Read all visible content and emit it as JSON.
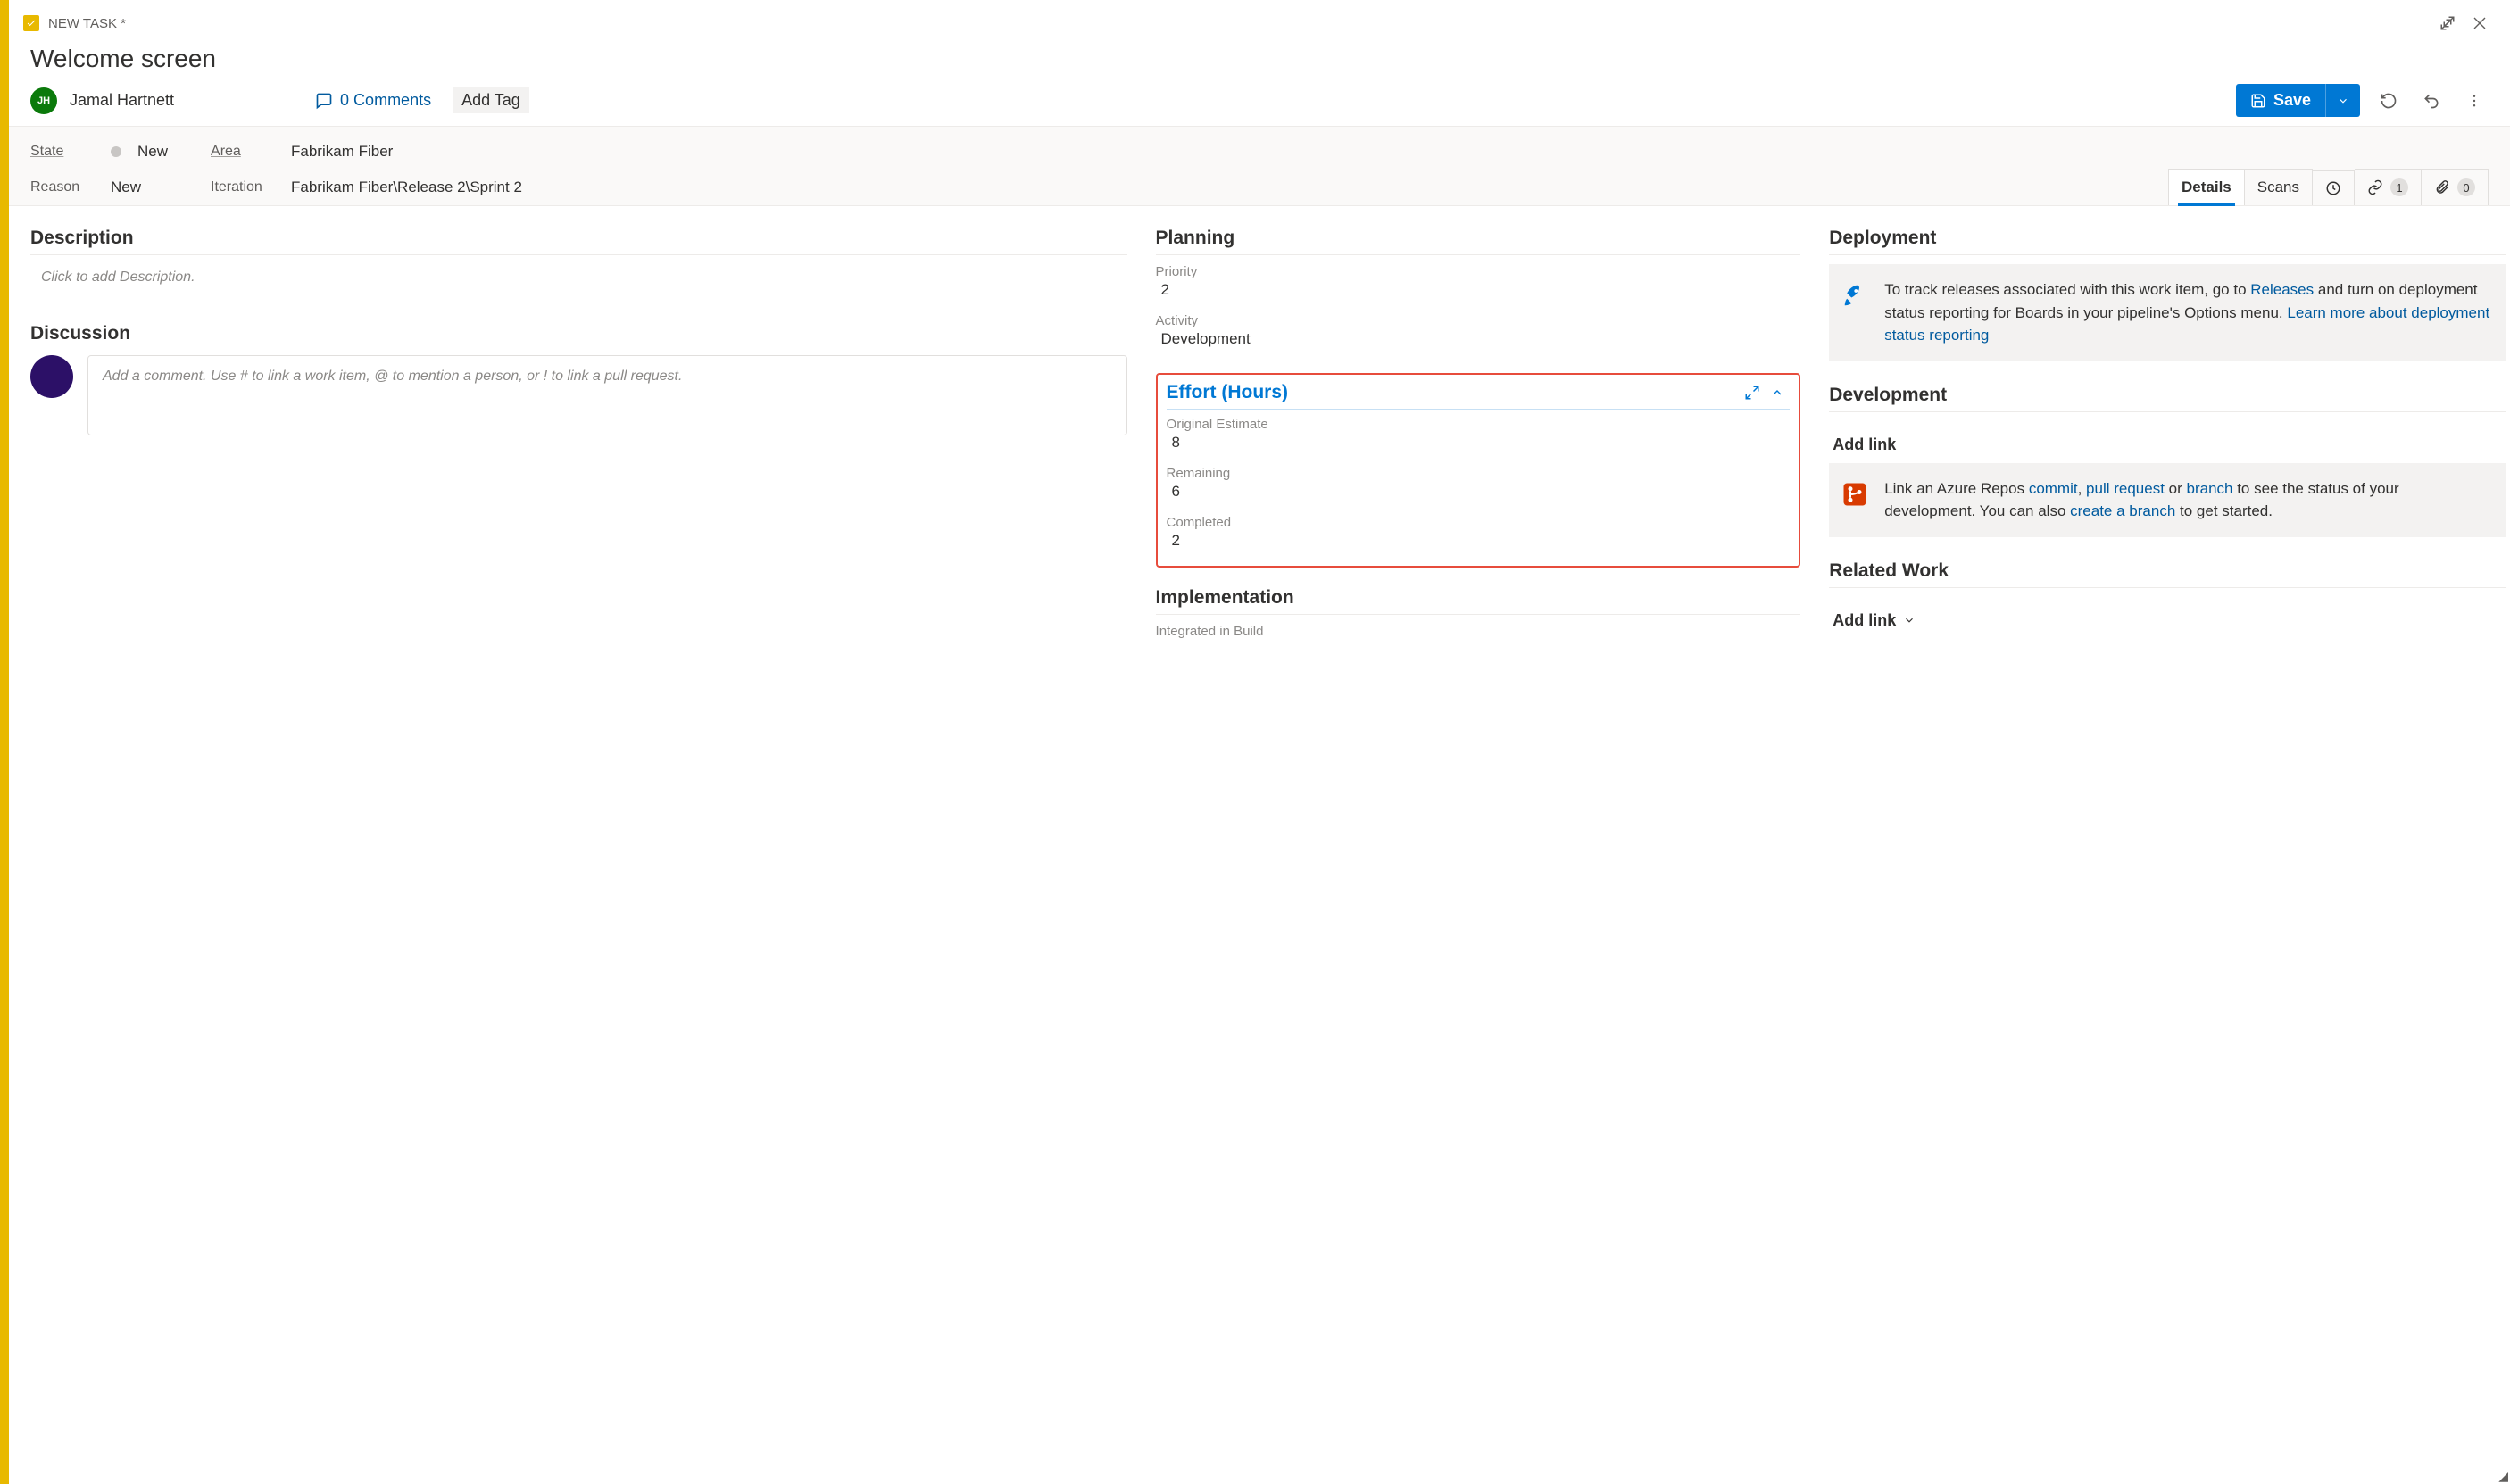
{
  "header": {
    "type_label": "NEW TASK *",
    "title": "Welcome screen"
  },
  "assignee": {
    "initials": "JH",
    "name": "Jamal Hartnett"
  },
  "comments_link": "0 Comments",
  "add_tag_label": "Add Tag",
  "save": {
    "label": "Save"
  },
  "classification": {
    "state_label": "State",
    "state_value": "New",
    "reason_label": "Reason",
    "reason_value": "New",
    "area_label": "Area",
    "area_value": "Fabrikam Fiber",
    "iteration_label": "Iteration",
    "iteration_value": "Fabrikam Fiber\\Release 2\\Sprint 2"
  },
  "tabs": {
    "details": "Details",
    "scans": "Scans",
    "links_count": "1",
    "attachments_count": "0"
  },
  "sections": {
    "description": "Description",
    "description_placeholder": "Click to add Description.",
    "discussion": "Discussion",
    "discussion_placeholder": "Add a comment. Use # to link a work item, @ to mention a person, or ! to link a pull request.",
    "planning": "Planning",
    "implementation": "Implementation",
    "integrated_in_build": "Integrated in Build",
    "deployment": "Deployment",
    "development": "Development",
    "related_work": "Related Work",
    "add_link": "Add link"
  },
  "planning": {
    "priority_label": "Priority",
    "priority_value": "2",
    "activity_label": "Activity",
    "activity_value": "Development"
  },
  "effort": {
    "title": "Effort (Hours)",
    "original_estimate_label": "Original Estimate",
    "original_estimate_value": "8",
    "remaining_label": "Remaining",
    "remaining_value": "6",
    "completed_label": "Completed",
    "completed_value": "2"
  },
  "deployment_text": {
    "pre": "To track releases associated with this work item, go to ",
    "link1": "Releases",
    "mid": " and turn on deployment status reporting for Boards in your pipeline's Options menu. ",
    "link2": "Learn more about deployment status reporting"
  },
  "development_text": {
    "pre": "Link an Azure Repos ",
    "commit": "commit",
    "c1": ", ",
    "pull_request": "pull request",
    "c2": " or ",
    "branch": "branch",
    "mid": " to see the status of your development. You can also ",
    "create_branch": "create a branch",
    "post": " to get started."
  }
}
